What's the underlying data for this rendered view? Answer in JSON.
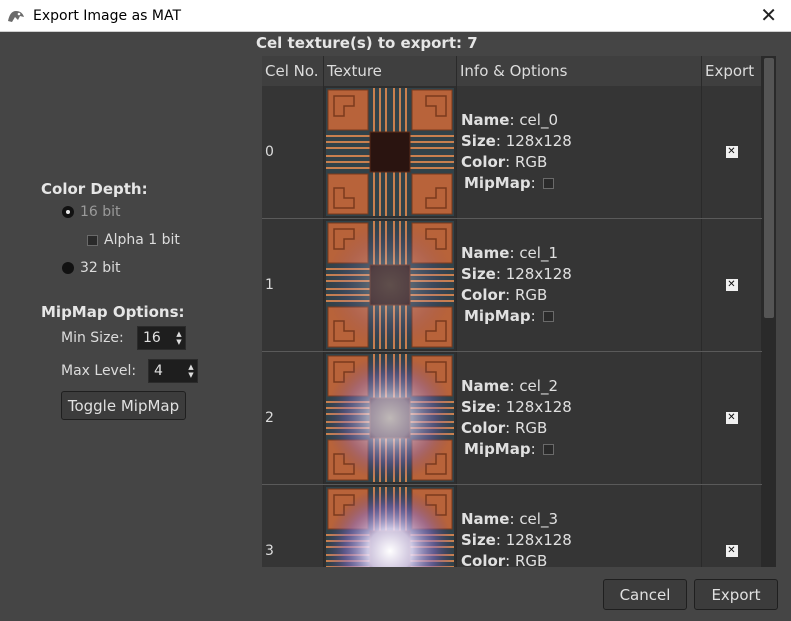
{
  "window": {
    "title": "Export Image as MAT",
    "close_glyph": "✕"
  },
  "left": {
    "color_depth_label": "Color Depth:",
    "opt_16bit": "16 bit",
    "opt_alpha": "Alpha 1 bit",
    "opt_32bit": "32 bit",
    "mipmap_options_label": "MipMap Options:",
    "min_size_label": "Min Size:",
    "min_size_value": "16",
    "max_level_label": "Max Level:",
    "max_level_value": "4",
    "toggle_button": "Toggle MipMap"
  },
  "table": {
    "title": "Cel texture(s) to export: 7",
    "headers": [
      "Cel No.",
      "Texture",
      "Info & Options",
      "Export"
    ],
    "field_labels": {
      "name": "Name",
      "size": "Size",
      "color": "Color",
      "mipmap": "MipMap"
    },
    "rows": [
      {
        "cel": "0",
        "name": "cel_0",
        "size": "128x128",
        "color": "RGB",
        "glow": 0.0
      },
      {
        "cel": "1",
        "name": "cel_1",
        "size": "128x128",
        "color": "RGB",
        "glow": 0.25
      },
      {
        "cel": "2",
        "name": "cel_2",
        "size": "128x128",
        "color": "RGB",
        "glow": 0.7
      },
      {
        "cel": "3",
        "name": "cel_3",
        "size": "128x128",
        "color": "RGB",
        "glow": 1.0
      }
    ]
  },
  "buttons": {
    "cancel": "Cancel",
    "export": "Export"
  },
  "colors": {
    "bg": "#454545",
    "table_bg": "#353535",
    "copper": "#b8633a",
    "glow": "#ffffff"
  }
}
